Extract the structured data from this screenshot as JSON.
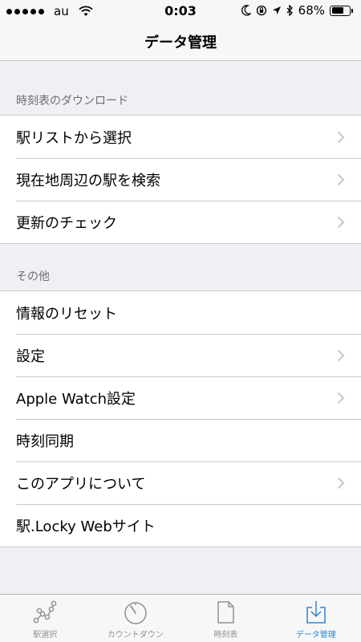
{
  "status_bar": {
    "carrier": "au",
    "time": "0:03",
    "battery": "68%",
    "battery_level": 0.68
  },
  "nav": {
    "title": "データ管理"
  },
  "sections": [
    {
      "header": "時刻表のダウンロード",
      "rows": [
        {
          "label": "駅リストから選択",
          "chevron": true
        },
        {
          "label": "現在地周辺の駅を検索",
          "chevron": true
        },
        {
          "label": "更新のチェック",
          "chevron": true
        }
      ]
    },
    {
      "header": "その他",
      "rows": [
        {
          "label": "情報のリセット",
          "chevron": false
        },
        {
          "label": "設定",
          "chevron": true
        },
        {
          "label": "Apple Watch設定",
          "chevron": true
        },
        {
          "label": "時刻同期",
          "chevron": false
        },
        {
          "label": "このアプリについて",
          "chevron": true
        },
        {
          "label": "駅.Locky Webサイト",
          "chevron": false
        }
      ]
    }
  ],
  "tabs": [
    {
      "label": "駅選択",
      "icon": "station-graph-icon",
      "active": false
    },
    {
      "label": "カウントダウン",
      "icon": "countdown-dial-icon",
      "active": false
    },
    {
      "label": "時刻表",
      "icon": "document-icon",
      "active": false
    },
    {
      "label": "データ管理",
      "icon": "download-tray-icon",
      "active": true
    }
  ],
  "colors": {
    "accent": "#2a87d6",
    "background": "#efeff4",
    "separator": "#c8c7cc",
    "chevron": "#c7c7cc"
  }
}
